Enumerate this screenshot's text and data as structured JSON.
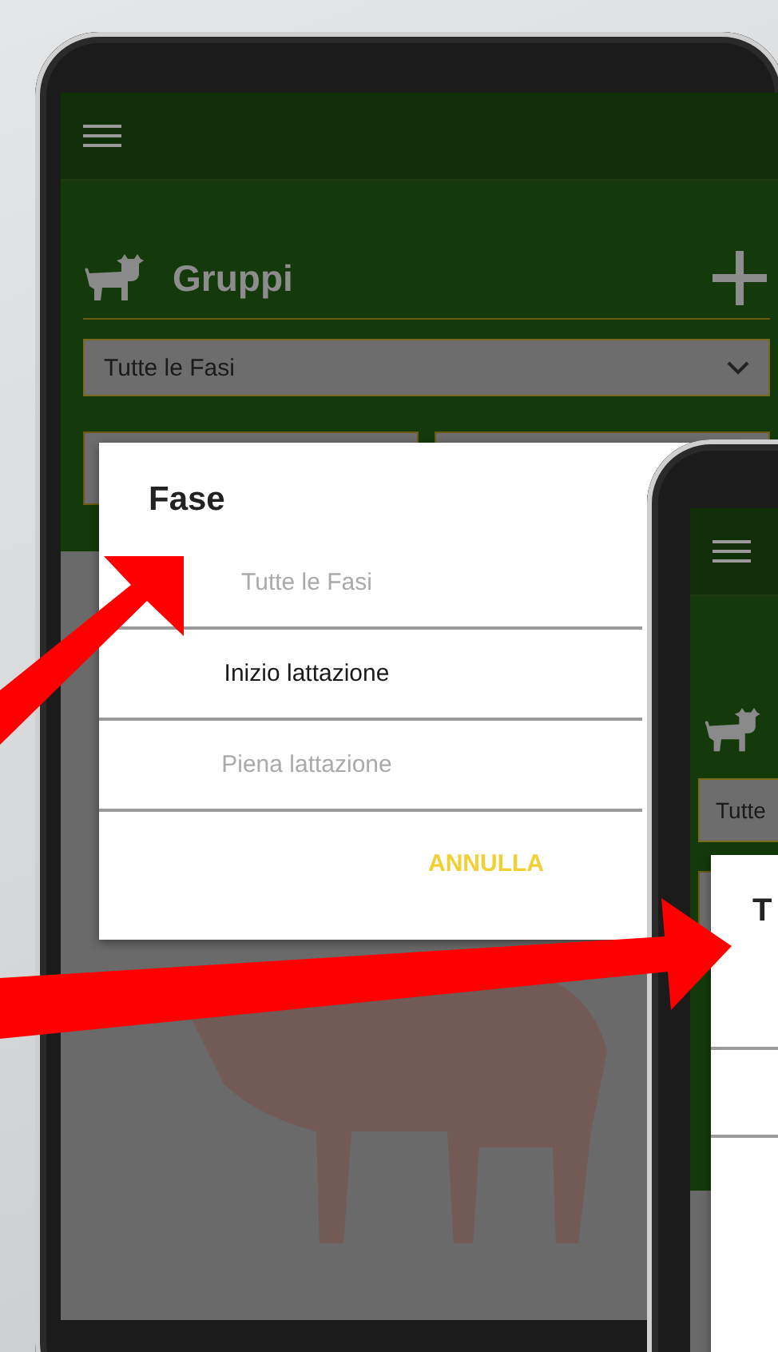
{
  "phone_main": {
    "title": "Gruppi",
    "phase_select": {
      "value": "Tutte le Fasi"
    },
    "dialog": {
      "title": "Fase",
      "options": [
        {
          "label": "Tutte le Fasi",
          "selected": false
        },
        {
          "label": "Inizio lattazione",
          "selected": true
        },
        {
          "label": "Piena lattazione",
          "selected": false
        }
      ],
      "buttons": [
        "ANNULLA"
      ]
    }
  },
  "phone_second": {
    "phase_select": {
      "value": "Tutte"
    },
    "dialog": {
      "title": "T"
    }
  }
}
